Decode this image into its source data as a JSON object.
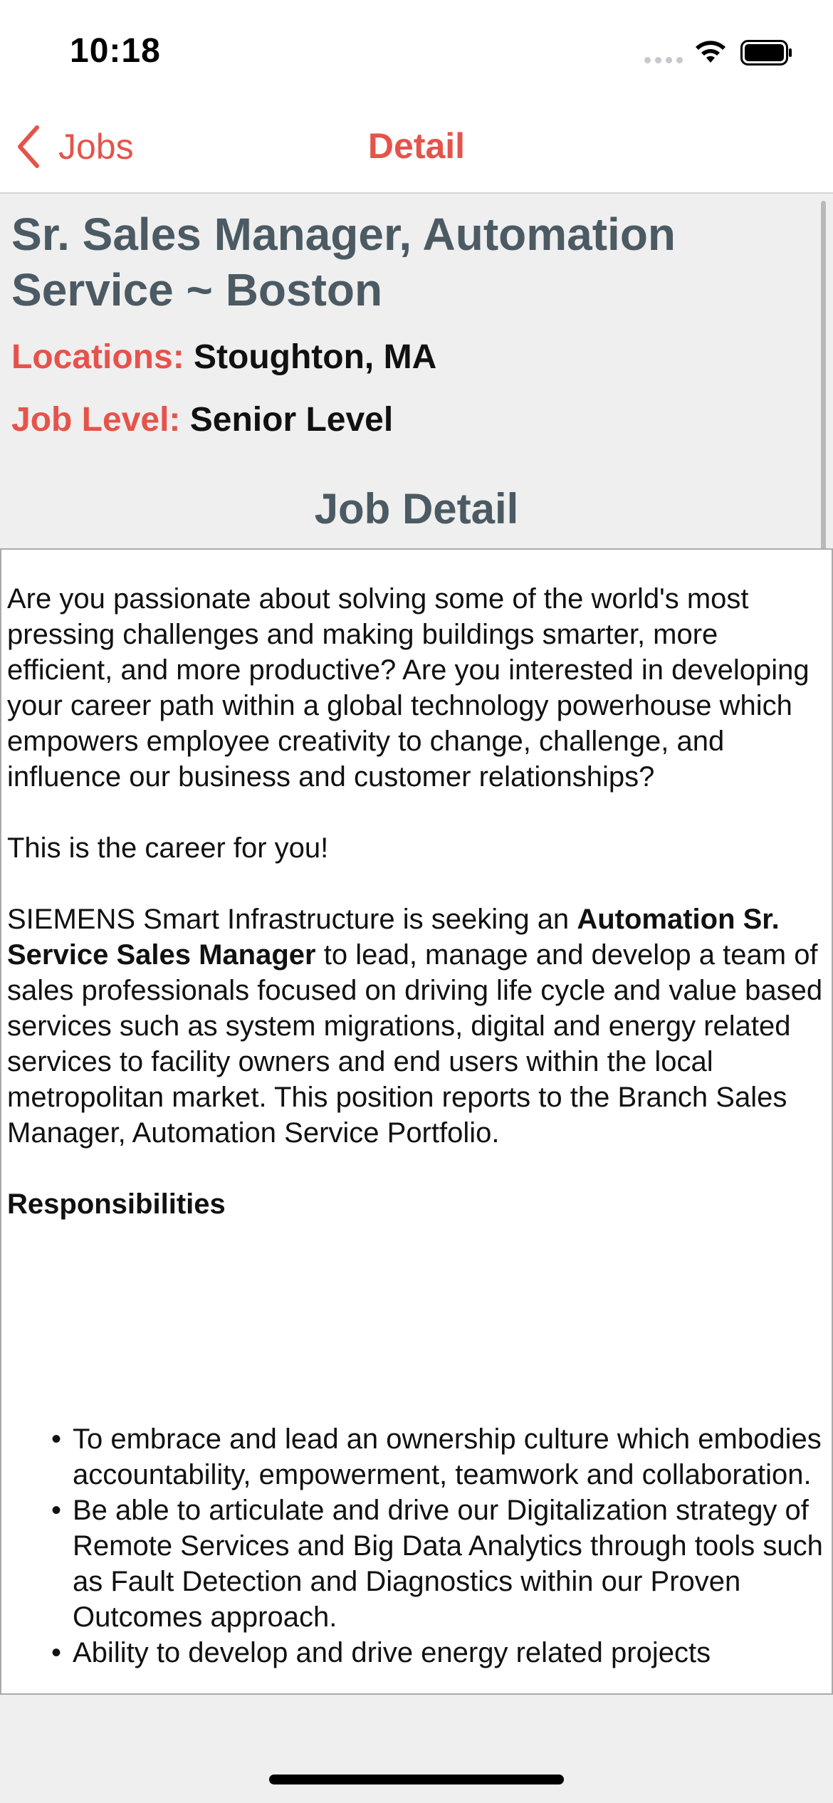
{
  "status_bar": {
    "time": "10:18",
    "icons": [
      "cellular-signal-icon",
      "wifi-icon",
      "battery-icon"
    ]
  },
  "navbar": {
    "back_label": "Jobs",
    "title": "Detail",
    "accent_color": "#e5534b"
  },
  "job": {
    "title": "Sr. Sales Manager, Automation Service ~ Boston",
    "locations_label": "Locations:",
    "locations_value": "Stoughton, MA",
    "level_label": "Job Level:",
    "level_value": "Senior Level",
    "detail_heading": "Job Detail"
  },
  "description": {
    "intro": "Are you passionate about solving some of the world's most pressing challenges and making buildings smarter, more efficient, and more productive? Are you interested in developing your career path within a global technology powerhouse which empowers employee creativity to change, challenge, and influence our business and customer relationships?",
    "tagline": "This is the career for you!",
    "company_lead": "SIEMENS Smart Infrastructure is seeking an",
    "role_bold": "Automation Sr. Service Sales Manager",
    "role_rest": "to lead, manage and develop a team of sales professionals focused on driving life cycle and value based services such as system migrations, digital and energy related services to facility owners and end users within the local metropolitan market. This position reports to the Branch Sales Manager, Automation Service Portfolio.",
    "responsibilities_heading": "Responsibilities",
    "responsibilities": [
      "To embrace and lead an ownership culture which embodies accountability, empowerment, teamwork and collaboration.",
      "Be able to articulate and drive our Digitalization strategy of Remote Services and Big Data Analytics through tools such as Fault Detection and Diagnostics within our Proven Outcomes approach.",
      "Ability to develop and drive energy related projects"
    ]
  }
}
